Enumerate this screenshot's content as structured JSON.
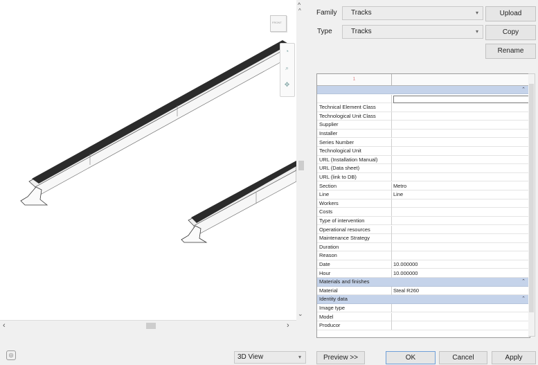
{
  "viewport": {
    "navcube_label": "FRONT",
    "nav_icons": [
      "rotate-icon",
      "zoom-icon",
      "pan-icon"
    ]
  },
  "header": {
    "family_label": "Family",
    "family_value": "Tracks",
    "type_label": "Type",
    "type_value": "Tracks",
    "upload_label": "Upload",
    "copy_label": "Copy",
    "rename_label": "Rename"
  },
  "grid": {
    "header_col1": "1",
    "rows": [
      {
        "kind": "group",
        "name": ""
      },
      {
        "kind": "input",
        "name": ""
      },
      {
        "kind": "row",
        "name": "Technical Element Class",
        "value": ""
      },
      {
        "kind": "row",
        "name": "Technological Unit Class",
        "value": ""
      },
      {
        "kind": "row",
        "name": "Supplier",
        "value": ""
      },
      {
        "kind": "row",
        "name": "Installer",
        "value": ""
      },
      {
        "kind": "row",
        "name": "Series Number",
        "value": ""
      },
      {
        "kind": "row",
        "name": "Technological Unit",
        "value": ""
      },
      {
        "kind": "row",
        "name": "URL (Installation Manual)",
        "value": ""
      },
      {
        "kind": "row",
        "name": "URL (Data sheet)",
        "value": ""
      },
      {
        "kind": "row",
        "name": "URL (link to DB)",
        "value": ""
      },
      {
        "kind": "row",
        "name": "Section",
        "value": "Metro"
      },
      {
        "kind": "row",
        "name": "Line",
        "value": "Line"
      },
      {
        "kind": "row",
        "name": "Workers",
        "value": ""
      },
      {
        "kind": "row",
        "name": "Costs",
        "value": ""
      },
      {
        "kind": "row",
        "name": "Type of intervention",
        "value": ""
      },
      {
        "kind": "row",
        "name": "Operational resources",
        "value": ""
      },
      {
        "kind": "row",
        "name": "Maintenance Strategy",
        "value": ""
      },
      {
        "kind": "row",
        "name": "Duration",
        "value": ""
      },
      {
        "kind": "row",
        "name": "Reason",
        "value": ""
      },
      {
        "kind": "row",
        "name": "Date",
        "value": "10.000000"
      },
      {
        "kind": "row",
        "name": "Hour",
        "value": "10.000000"
      },
      {
        "kind": "group",
        "name": "Materials and finishes"
      },
      {
        "kind": "row",
        "name": "Material",
        "value": "Steal R260"
      },
      {
        "kind": "group",
        "name": "Identity data"
      },
      {
        "kind": "row",
        "name": "Image type",
        "value": ""
      },
      {
        "kind": "row",
        "name": "Model",
        "value": ""
      },
      {
        "kind": "row",
        "name": "Producor",
        "value": ""
      }
    ]
  },
  "footer": {
    "view_select": "3D View",
    "preview_label": "Preview >>",
    "ok_label": "OK",
    "cancel_label": "Cancel",
    "apply_label": "Apply"
  }
}
